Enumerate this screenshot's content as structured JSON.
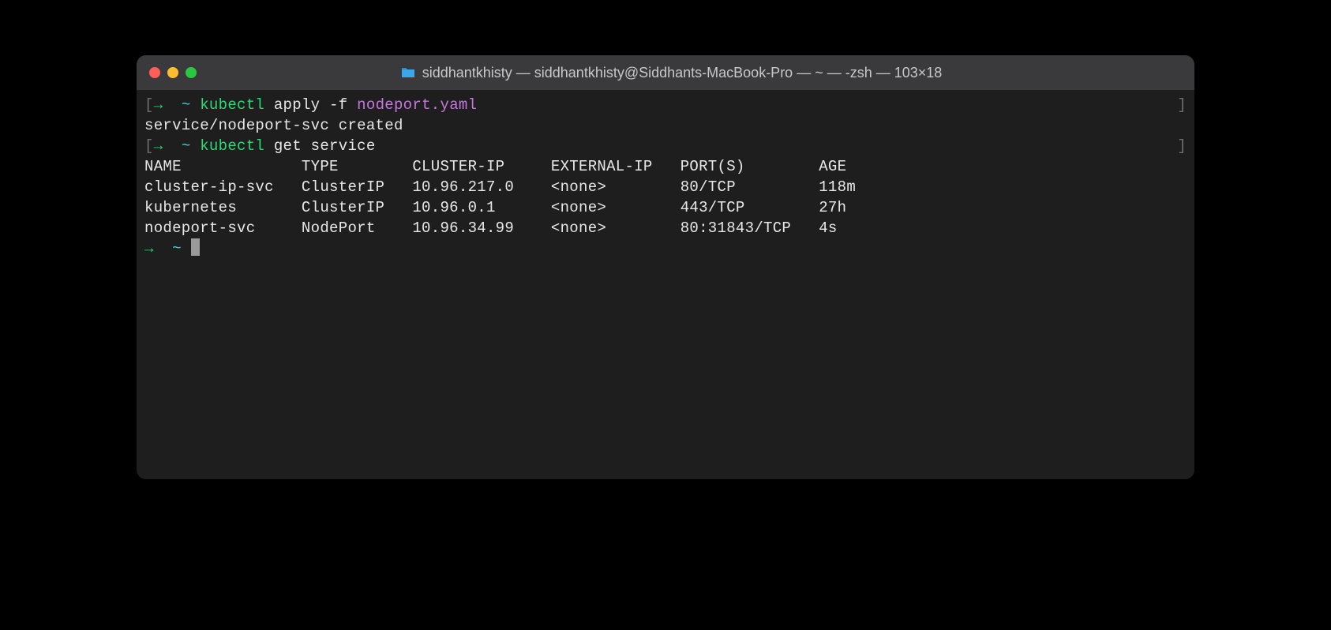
{
  "window": {
    "title": "siddhantkhisty — siddhantkhisty@Siddhants-MacBook-Pro — ~ — -zsh — 103×18"
  },
  "prompt": {
    "open_bracket": "[",
    "close_bracket": "]",
    "arrow": "→",
    "tilde": "~"
  },
  "commands": {
    "cmd1_kubectl": "kubectl",
    "cmd1_args": "apply -f",
    "cmd1_file": "nodeport.yaml",
    "cmd1_output": "service/nodeport-svc created",
    "cmd2_kubectl": "kubectl",
    "cmd2_args": "get service"
  },
  "table": {
    "headers": {
      "name": "NAME",
      "type": "TYPE",
      "cluster_ip": "CLUSTER-IP",
      "external_ip": "EXTERNAL-IP",
      "ports": "PORT(S)",
      "age": "AGE"
    },
    "rows": [
      {
        "name": "cluster-ip-svc",
        "type": "ClusterIP",
        "cluster_ip": "10.96.217.0",
        "external_ip": "<none>",
        "ports": "80/TCP",
        "age": "118m"
      },
      {
        "name": "kubernetes",
        "type": "ClusterIP",
        "cluster_ip": "10.96.0.1",
        "external_ip": "<none>",
        "ports": "443/TCP",
        "age": "27h"
      },
      {
        "name": "nodeport-svc",
        "type": "NodePort",
        "cluster_ip": "10.96.34.99",
        "external_ip": "<none>",
        "ports": "80:31843/TCP",
        "age": "4s"
      }
    ]
  },
  "columns": {
    "name_w": 17,
    "type_w": 12,
    "cluster_ip_w": 15,
    "external_ip_w": 14,
    "ports_w": 15
  }
}
